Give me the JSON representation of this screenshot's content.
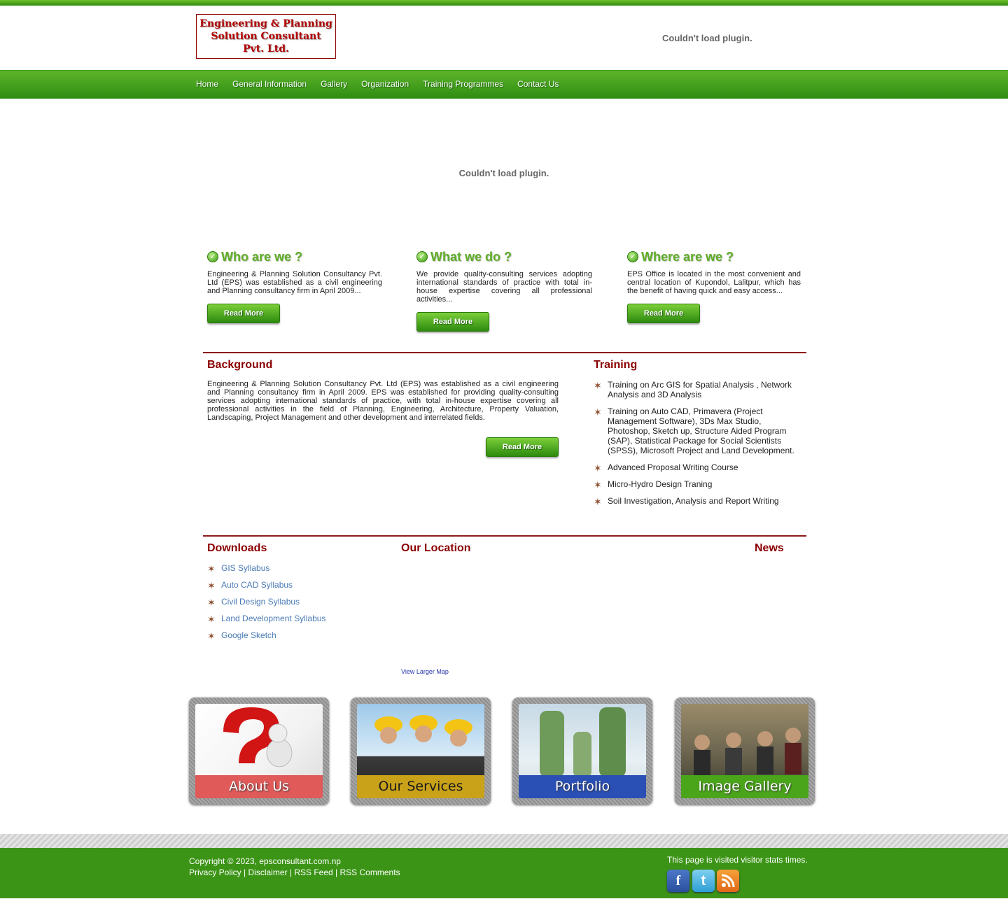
{
  "header": {
    "logo_lines": [
      "Engineering & Planning",
      "Solution Consultant",
      "Pvt. Ltd."
    ],
    "plugin_message": "Couldn't load plugin."
  },
  "nav": {
    "items": [
      "Home",
      "General Information",
      "Gallery",
      "Organization",
      "Training Programmes",
      "Contact Us"
    ]
  },
  "banner": {
    "plugin_message": "Couldn't load plugin."
  },
  "intro": [
    {
      "title": "Who are we ?",
      "text": "Engineering & Planning Solution Consultancy Pvt. Ltd (EPS) was established as a civil engineering and Planning consultancy firm in April 2009...",
      "button": "Read More"
    },
    {
      "title": "What we do ?",
      "text": "We provide quality-consulting services adopting international standards of practice with total in-house expertise covering all professional activities...",
      "button": "Read More"
    },
    {
      "title": "Where are we ?",
      "text": "EPS Office is located in the most convenient and central location of Kupondol, Lalitpur, which has the benefit of having quick and easy access...",
      "button": "Read More"
    }
  ],
  "background": {
    "heading": "Background",
    "text": "Engineering & Planning Solution Consultancy Pvt. Ltd (EPS) was established as a civil engineering and Planning consultancy firm in April 2009. EPS was established for providing quality-consulting services adopting international standards of practice, with total in-house expertise covering all professional activities in the field of Planning, Engineering, Architecture, Property Valuation, Landscaping, Project Management and other development and interrelated fields.",
    "button": "Read More"
  },
  "training": {
    "heading": "Training",
    "items": [
      "Training on Arc GIS for Spatial Analysis , Network Analysis and 3D Analysis",
      "Training on Auto CAD, Primavera (Project Management Software), 3Ds Max Studio, Photoshop, Sketch up, Structure Aided Program (SAP), Statistical Package for Social Scientists (SPSS), Microsoft Project and Land Development.",
      "Advanced Proposal Writing Course",
      "Micro-Hydro Design Traning",
      "Soil Investigation, Analysis and Report Writing"
    ]
  },
  "downloads": {
    "heading": "Downloads",
    "items": [
      "GIS Syllabus",
      "Auto CAD Syllabus",
      "Civil Design Syllabus",
      "Land Development Syllabus",
      "Google Sketch"
    ]
  },
  "location": {
    "heading": "Our Location",
    "map_link": "View Larger Map"
  },
  "news": {
    "heading": "News"
  },
  "cards": [
    {
      "label": "About Us",
      "banner_color": "#e05a5a"
    },
    {
      "label": "Our Services",
      "banner_color": "#c9a21a"
    },
    {
      "label": "Portfolio",
      "banner_color": "#2a4fb5"
    },
    {
      "label": "Image Gallery",
      "banner_color": "#4aa51a"
    }
  ],
  "footer": {
    "copyright": "Copyright © 2023, epsconsultant.com.np",
    "links": [
      "Privacy Policy",
      "Disclaimer",
      "RSS Feed",
      "RSS Comments"
    ],
    "separator": "|",
    "visit_text": "This page is visited",
    "visit_img_alt": "visitor stats",
    "visit_suffix": "times.",
    "social": [
      "facebook-icon",
      "twitter-icon",
      "rss-icon"
    ]
  }
}
